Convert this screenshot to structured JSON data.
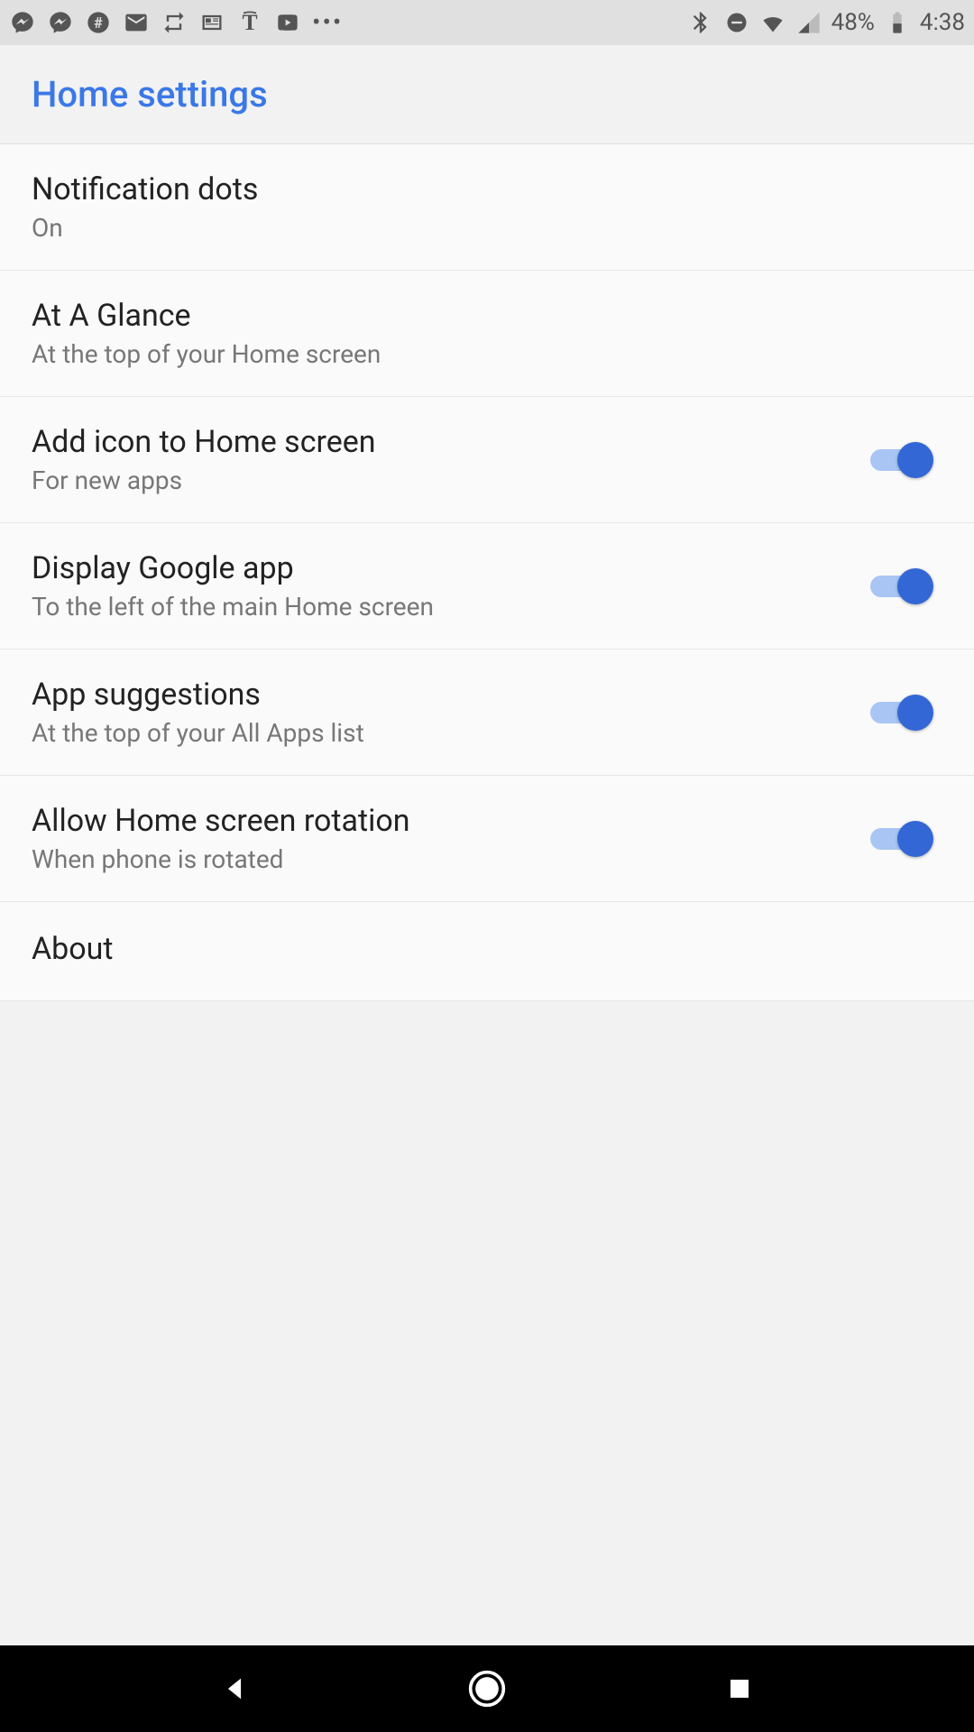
{
  "status_bar": {
    "battery": "48%",
    "time": "4:38"
  },
  "header": {
    "title": "Home settings"
  },
  "settings": [
    {
      "title": "Notification dots",
      "subtitle": "On",
      "toggle": false
    },
    {
      "title": "At A Glance",
      "subtitle": "At the top of your Home screen",
      "toggle": false
    },
    {
      "title": "Add icon to Home screen",
      "subtitle": "For new apps",
      "toggle": true,
      "toggle_on": true
    },
    {
      "title": "Display Google app",
      "subtitle": "To the left of the main Home screen",
      "toggle": true,
      "toggle_on": true
    },
    {
      "title": "App suggestions",
      "subtitle": "At the top of your All Apps list",
      "toggle": true,
      "toggle_on": true
    },
    {
      "title": "Allow Home screen rotation",
      "subtitle": "When phone is rotated",
      "toggle": true,
      "toggle_on": true
    },
    {
      "title": "About",
      "subtitle": "",
      "toggle": false
    }
  ]
}
